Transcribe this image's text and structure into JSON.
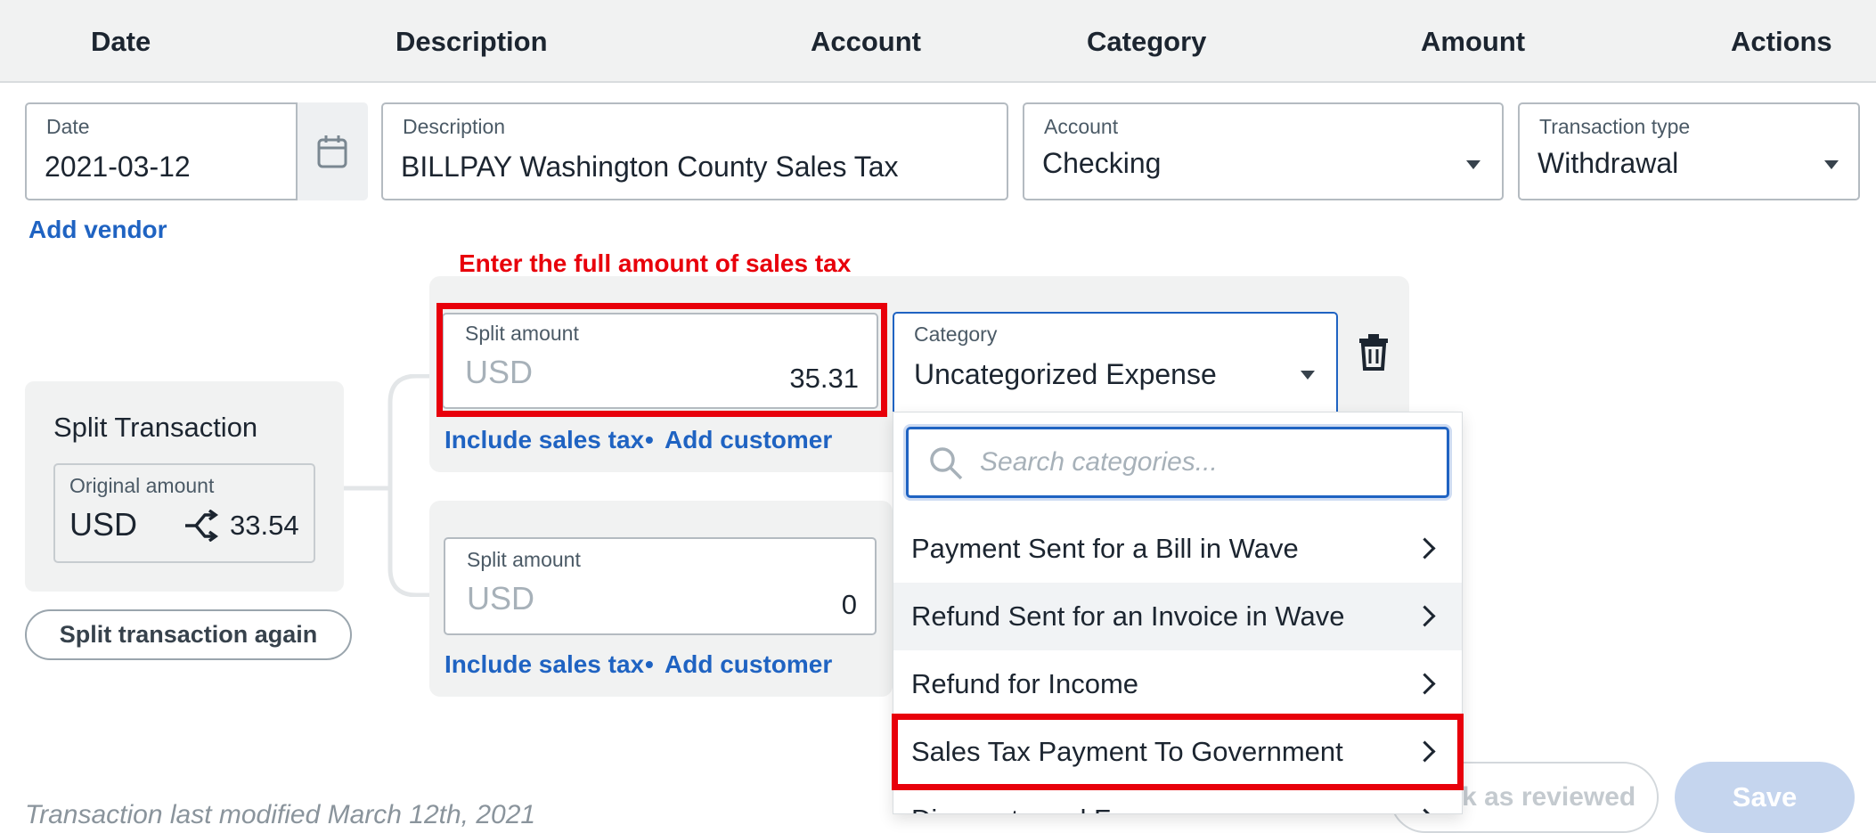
{
  "header": {
    "columns": [
      "Date",
      "Description",
      "Account",
      "Category",
      "Amount",
      "Actions"
    ]
  },
  "form": {
    "date": {
      "label": "Date",
      "value": "2021-03-12"
    },
    "description": {
      "label": "Description",
      "value": "BILLPAY Washington County Sales Tax"
    },
    "account": {
      "label": "Account",
      "value": "Checking"
    },
    "transaction_type": {
      "label": "Transaction type",
      "value": "Withdrawal"
    },
    "add_vendor": "Add vendor"
  },
  "split_panel": {
    "title": "Split Transaction",
    "original_label": "Original amount",
    "currency": "USD",
    "original_value": "33.54",
    "split_again": "Split transaction again"
  },
  "annotation": {
    "text": "Enter the full amount of sales tax",
    "color": "#e8000b"
  },
  "splits": [
    {
      "amount_label": "Split amount",
      "currency": "USD",
      "amount": "35.31",
      "include_tax": "Include sales tax",
      "separator": "•",
      "add_customer": "Add customer",
      "category_label": "Category",
      "category_value": "Uncategorized Expense"
    },
    {
      "amount_label": "Split amount",
      "currency": "USD",
      "amount": "0",
      "include_tax": "Include sales tax",
      "separator": "•",
      "add_customer": "Add customer"
    }
  ],
  "dropdown": {
    "search_placeholder": "Search categories...",
    "items": [
      "Payment Sent for a Bill in Wave",
      "Refund Sent for an Invoice in Wave",
      "Refund for Income",
      "Sales Tax Payment To Government",
      "Discounts and Fees"
    ]
  },
  "footer": {
    "modified": "Transaction last modified March 12th, 2021",
    "mark_reviewed": "Mark as reviewed",
    "save": "Save"
  },
  "colors": {
    "accent": "#1f63c2",
    "highlight": "#e8000b",
    "header_bg": "#f1f2f2",
    "panel_bg": "#f1f2f2",
    "save_bg": "#c5d5ee"
  }
}
